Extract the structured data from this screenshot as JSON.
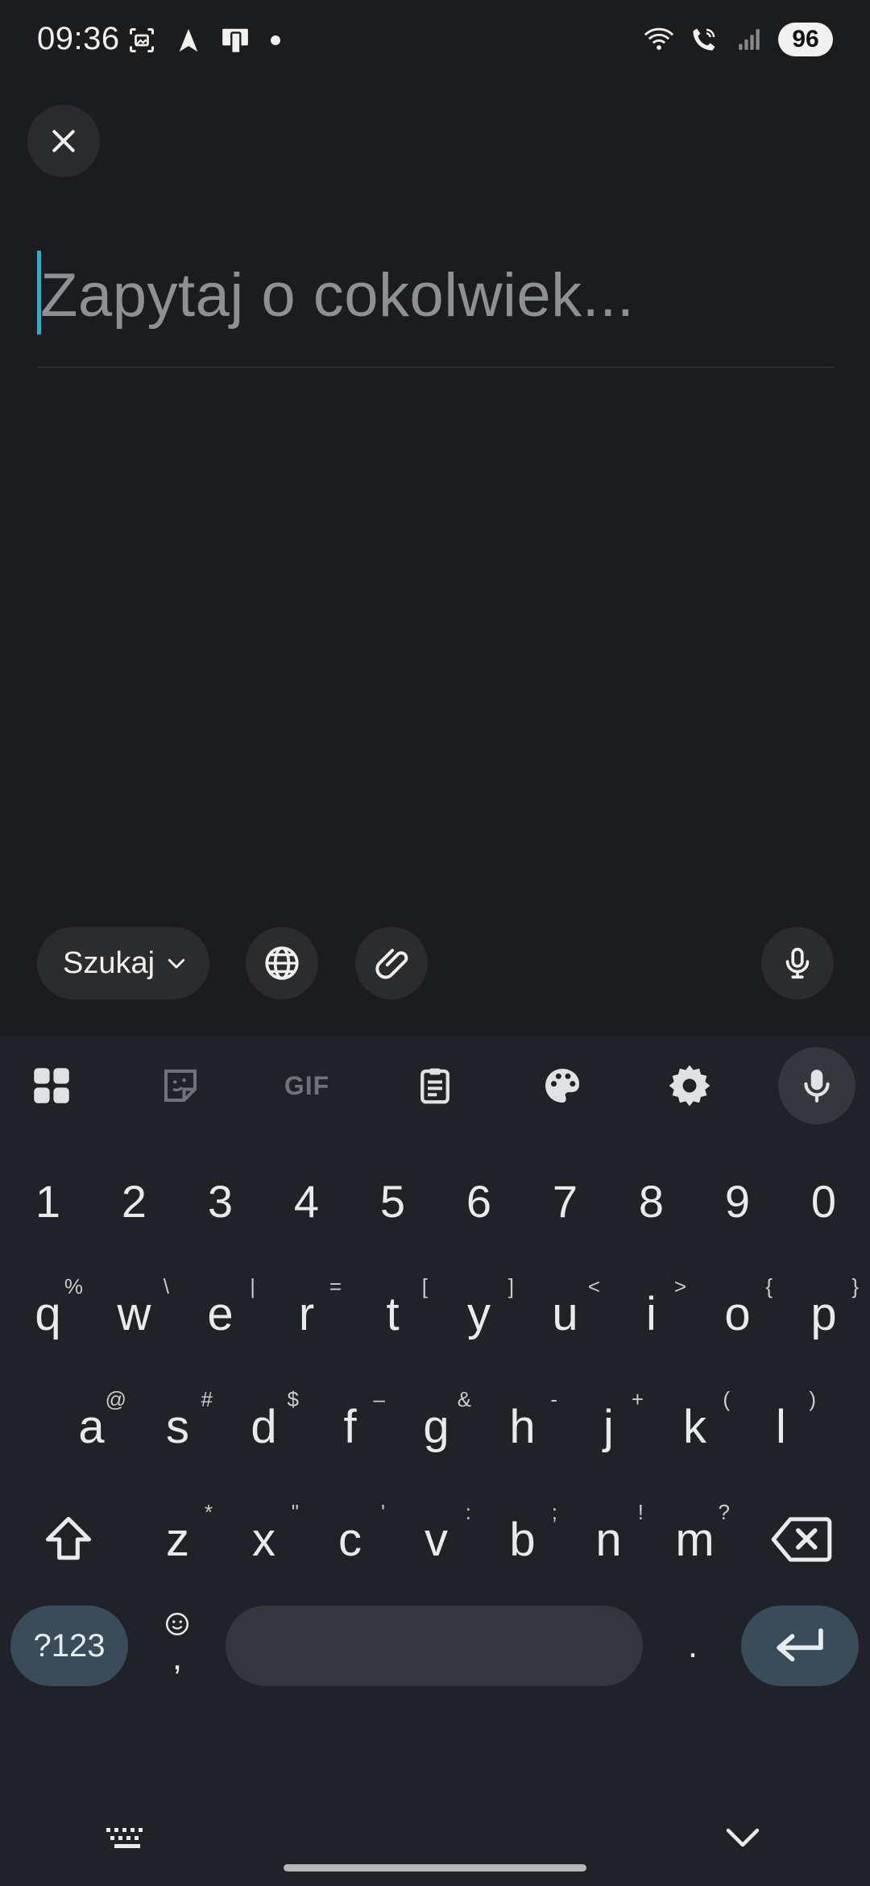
{
  "status_bar": {
    "time": "09:36",
    "battery": "96"
  },
  "query": {
    "placeholder": "Zapytaj o cokolwiek..."
  },
  "actions": {
    "search_label": "Szukaj"
  },
  "keyboard": {
    "toolbar": {
      "gif_label": "GIF"
    },
    "numbers": [
      "1",
      "2",
      "3",
      "4",
      "5",
      "6",
      "7",
      "8",
      "9",
      "0"
    ],
    "row1": [
      {
        "k": "q",
        "h": "%"
      },
      {
        "k": "w",
        "h": "\\"
      },
      {
        "k": "e",
        "h": "|"
      },
      {
        "k": "r",
        "h": "="
      },
      {
        "k": "t",
        "h": "["
      },
      {
        "k": "y",
        "h": "]"
      },
      {
        "k": "u",
        "h": "<"
      },
      {
        "k": "i",
        "h": ">"
      },
      {
        "k": "o",
        "h": "{"
      },
      {
        "k": "p",
        "h": "}"
      }
    ],
    "row2": [
      {
        "k": "a",
        "h": "@"
      },
      {
        "k": "s",
        "h": "#"
      },
      {
        "k": "d",
        "h": "$"
      },
      {
        "k": "f",
        "h": "–"
      },
      {
        "k": "g",
        "h": "&"
      },
      {
        "k": "h",
        "h": "-"
      },
      {
        "k": "j",
        "h": "+"
      },
      {
        "k": "k",
        "h": "("
      },
      {
        "k": "l",
        "h": ")"
      }
    ],
    "row3": [
      {
        "k": "z",
        "h": "*"
      },
      {
        "k": "x",
        "h": "\""
      },
      {
        "k": "c",
        "h": "'"
      },
      {
        "k": "v",
        "h": ":"
      },
      {
        "k": "b",
        "h": ";"
      },
      {
        "k": "n",
        "h": "!"
      },
      {
        "k": "m",
        "h": "?"
      }
    ],
    "symbols_label": "?123",
    "comma_label": ",",
    "period_label": "."
  }
}
